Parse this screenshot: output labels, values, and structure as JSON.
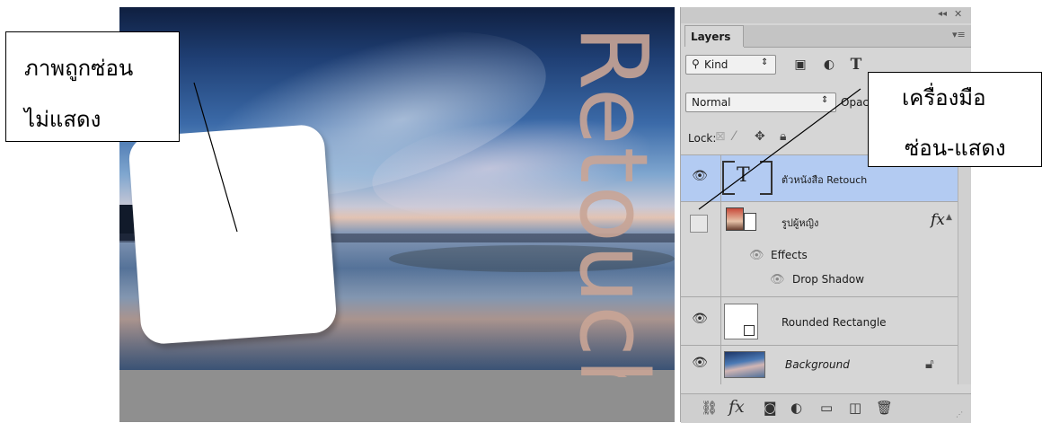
{
  "canvas": {
    "text_layer_content": "Retouch"
  },
  "callouts": {
    "hidden": {
      "line1": "ภาพถูกซ่อน",
      "line2": "ไม่แสดง"
    },
    "tool": {
      "line1": "เครื่องมือ",
      "line2": "ซ่อน-แสดง"
    }
  },
  "panel": {
    "tab": "Layers",
    "filter": {
      "kind_label": "Kind",
      "type_icon_glyph": "T"
    },
    "blend_mode": "Normal",
    "opacity_label": "Opac",
    "lock_label": "Lock:",
    "layers": [
      {
        "name": "ตัวหนังสือ Retouch",
        "visible": true,
        "selected": true,
        "kind": "type",
        "thumb_glyph": "T"
      },
      {
        "name": "รูปผู้หญิง",
        "visible": false,
        "selected": false,
        "kind": "smart-object",
        "fx_label": "fx",
        "effects_label": "Effects",
        "effect_items": [
          "Drop Shadow"
        ]
      },
      {
        "name": "Rounded Rectangle",
        "visible": true,
        "selected": false,
        "kind": "shape"
      },
      {
        "name": "Background",
        "visible": true,
        "selected": false,
        "kind": "background",
        "locked": true
      }
    ],
    "bottom_bar": {
      "fx_label": "fx"
    }
  },
  "colors": {
    "selected_row": "#b3cbf2",
    "panel_bg": "#d6d6d6",
    "workspace_bg": "#8f8f8f",
    "retouch_text": "#c9a596"
  }
}
